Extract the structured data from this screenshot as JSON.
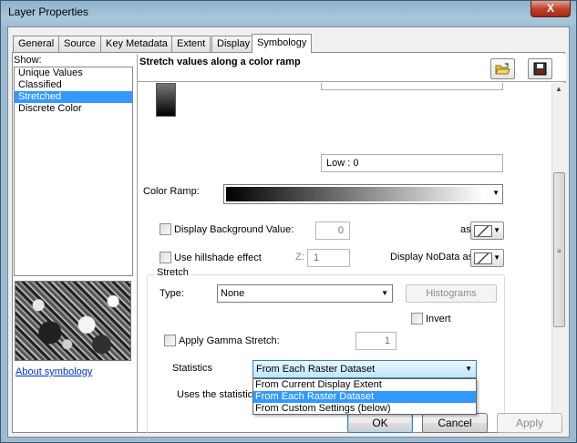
{
  "window": {
    "title": "Layer Properties",
    "close_glyph": "X"
  },
  "tabs": [
    {
      "label": "General"
    },
    {
      "label": "Source"
    },
    {
      "label": "Key Metadata"
    },
    {
      "label": "Extent"
    },
    {
      "label": "Display"
    },
    {
      "label": "Symbology",
      "active": true
    }
  ],
  "show": {
    "label": "Show:",
    "items": [
      {
        "label": "Unique Values"
      },
      {
        "label": "Classified"
      },
      {
        "label": "Stretched",
        "selected": true
      },
      {
        "label": "Discrete Color"
      }
    ]
  },
  "about_link": "About symbology",
  "panel": {
    "title": "Stretch values along a color ramp",
    "open_icon": "open-folder-icon",
    "save_icon": "save-disk-icon"
  },
  "ramp": {
    "high_value": "",
    "low_value": "Low : 0",
    "color_ramp_label": "Color Ramp:"
  },
  "background": {
    "label": "Display Background Value:",
    "value": "0",
    "as_label": "as",
    "checked": false
  },
  "hillshade": {
    "label": "Use hillshade effect",
    "z_label": "Z:",
    "z_value": "1",
    "checked": false
  },
  "nodata": {
    "label": "Display NoData as"
  },
  "stretch": {
    "group_title": "Stretch",
    "type_label": "Type:",
    "type_value": "None",
    "histograms_button": "Histograms",
    "invert_label": "Invert",
    "gamma_label": "Apply Gamma Stretch:",
    "gamma_value": "1",
    "statistics_label": "Statistics",
    "statistics_value": "From Each Raster Dataset",
    "statistics_options": [
      {
        "label": "From Current Display Extent"
      },
      {
        "label": "From Each Raster Dataset",
        "selected": true
      },
      {
        "label": "From Custom Settings (below)"
      }
    ],
    "uses_text": "Uses the statistic"
  },
  "footer": {
    "ok": "OK",
    "cancel": "Cancel",
    "apply": "Apply"
  }
}
